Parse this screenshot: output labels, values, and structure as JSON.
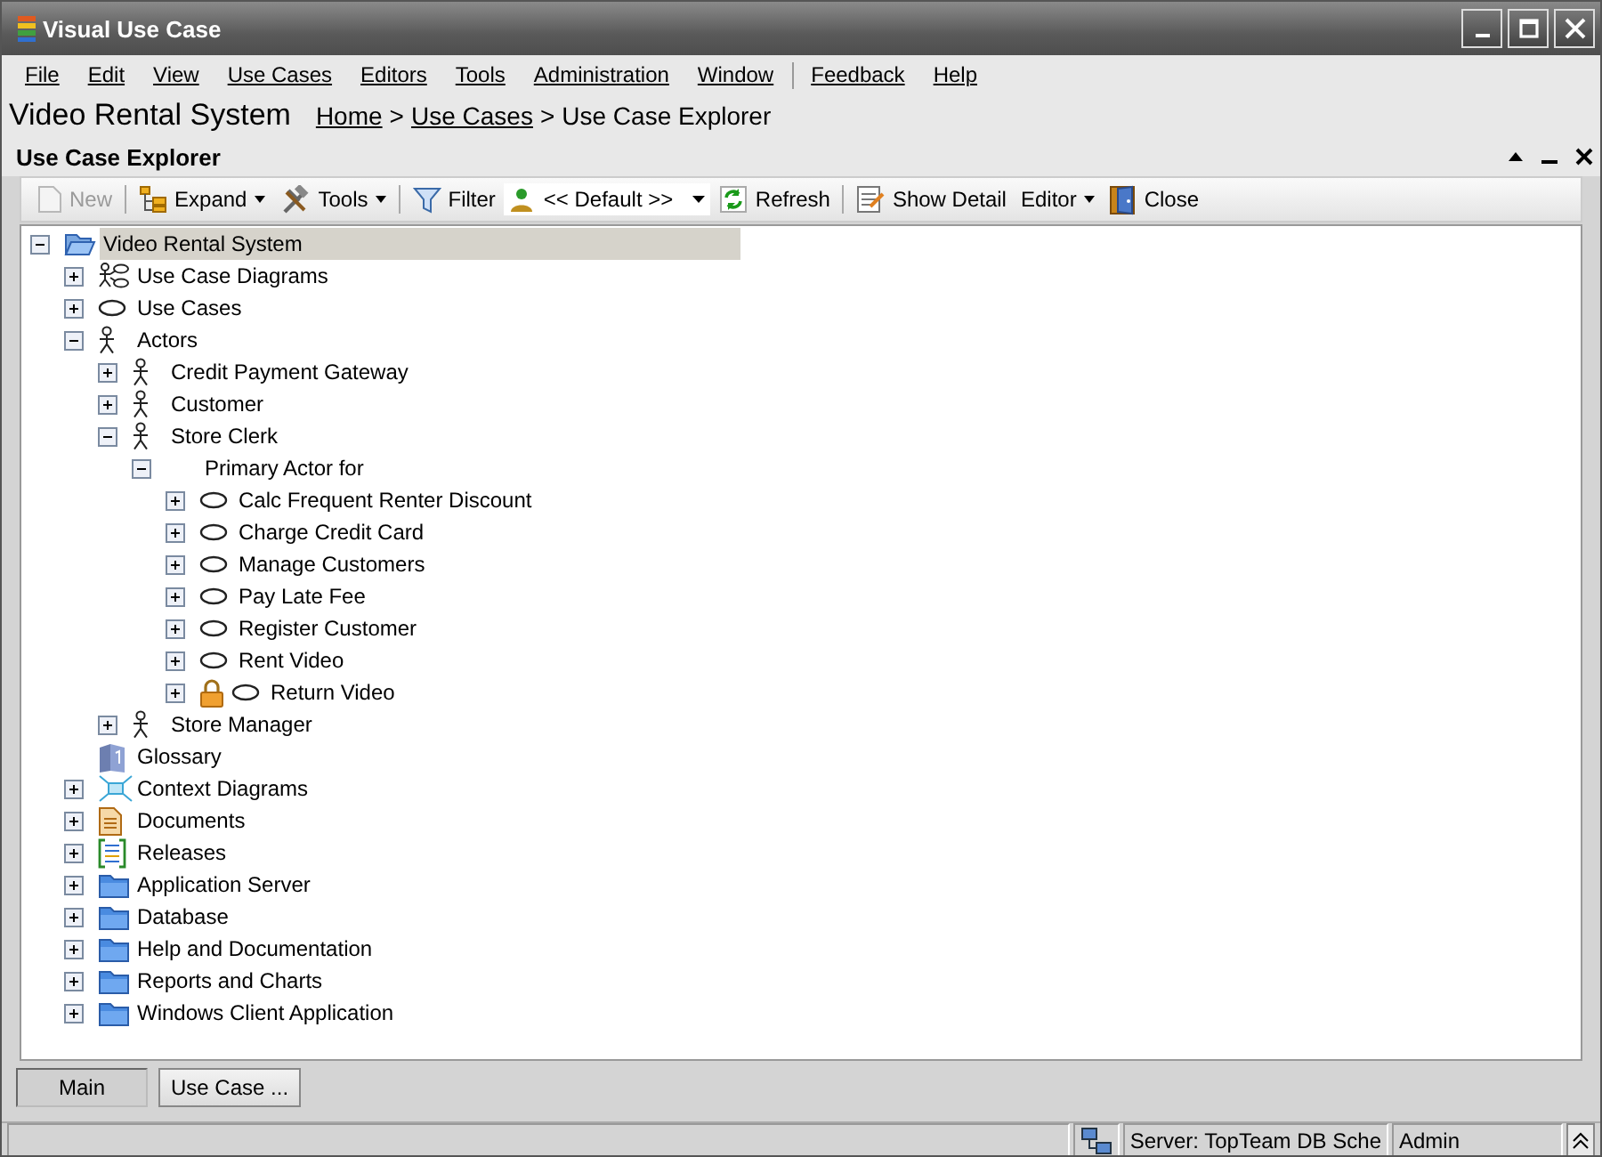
{
  "window": {
    "title": "Visual Use Case"
  },
  "menu": [
    {
      "kind": "item",
      "label": "File"
    },
    {
      "kind": "item",
      "label": "Edit"
    },
    {
      "kind": "item",
      "label": "View"
    },
    {
      "kind": "item",
      "label": "Use Cases"
    },
    {
      "kind": "item",
      "label": "Editors"
    },
    {
      "kind": "item",
      "label": "Tools"
    },
    {
      "kind": "item",
      "label": "Administration"
    },
    {
      "kind": "item",
      "label": "Window"
    },
    {
      "kind": "separator"
    },
    {
      "kind": "item",
      "label": "Feedback"
    },
    {
      "kind": "item",
      "label": "Help"
    }
  ],
  "header": {
    "title": "Video Rental System",
    "breadcrumb": [
      {
        "kind": "link",
        "label": "Home"
      },
      {
        "kind": "sep",
        "label": ">"
      },
      {
        "kind": "link",
        "label": "Use Cases"
      },
      {
        "kind": "sep",
        "label": ">"
      },
      {
        "kind": "text",
        "label": "Use Case Explorer"
      }
    ]
  },
  "panel": {
    "title": "Use Case Explorer"
  },
  "toolbar": [
    {
      "kind": "button",
      "label": "New",
      "disabled": true
    },
    {
      "kind": "separator"
    },
    {
      "kind": "dropdown",
      "label": "Expand",
      "disabled": false
    },
    {
      "kind": "dropdown",
      "label": "Tools",
      "disabled": false
    },
    {
      "kind": "separator"
    },
    {
      "kind": "button",
      "label": "Filter",
      "disabled": false
    },
    {
      "kind": "combo",
      "value": "<< Default >>"
    },
    {
      "kind": "button",
      "label": "Refresh",
      "disabled": false
    },
    {
      "kind": "separator"
    },
    {
      "kind": "button",
      "label": "Show Detail",
      "disabled": false
    },
    {
      "kind": "dropdown",
      "label": "Editor",
      "disabled": false
    },
    {
      "kind": "button",
      "label": "Close",
      "disabled": false
    }
  ],
  "tree": [
    {
      "label": "Video Rental System",
      "kind": "folder-open",
      "expanded": true,
      "selected": true,
      "children": [
        {
          "label": "Use Case Diagrams",
          "kind": "diagram",
          "expanded": false,
          "selected": false
        },
        {
          "label": "Use Cases",
          "kind": "usecase",
          "expanded": false,
          "selected": false
        },
        {
          "label": "Actors",
          "kind": "actor",
          "expanded": true,
          "selected": false,
          "children": [
            {
              "label": "Credit Payment Gateway",
              "kind": "actor",
              "expanded": false,
              "selected": false
            },
            {
              "label": "Customer",
              "kind": "actor",
              "expanded": false,
              "selected": false
            },
            {
              "label": "Store Clerk",
              "kind": "actor",
              "expanded": true,
              "selected": false,
              "children": [
                {
                  "label": "Primary Actor for",
                  "expanded": true,
                  "selected": false,
                  "children": [
                    {
                      "label": "Calc Frequent Renter Discount",
                      "kind": "usecase",
                      "locked": false,
                      "expanded": false,
                      "selected": false
                    },
                    {
                      "label": "Charge Credit Card",
                      "kind": "usecase",
                      "locked": false,
                      "expanded": false,
                      "selected": false
                    },
                    {
                      "label": "Manage Customers",
                      "kind": "usecase",
                      "locked": false,
                      "expanded": false,
                      "selected": false
                    },
                    {
                      "label": "Pay Late Fee",
                      "kind": "usecase",
                      "locked": false,
                      "expanded": false,
                      "selected": false
                    },
                    {
                      "label": "Register Customer",
                      "kind": "usecase",
                      "locked": false,
                      "expanded": false,
                      "selected": false
                    },
                    {
                      "label": "Rent Video",
                      "kind": "usecase",
                      "locked": false,
                      "expanded": false,
                      "selected": false
                    },
                    {
                      "label": "Return Video",
                      "kind": "usecase",
                      "locked": true,
                      "expanded": false,
                      "selected": false
                    }
                  ]
                }
              ]
            },
            {
              "label": "Store Manager",
              "kind": "actor",
              "expanded": false,
              "selected": false
            }
          ]
        },
        {
          "label": "Glossary",
          "kind": "book",
          "selected": false
        },
        {
          "label": "Context Diagrams",
          "kind": "context",
          "expanded": false,
          "selected": false
        },
        {
          "label": "Documents",
          "kind": "document",
          "expanded": false,
          "selected": false
        },
        {
          "label": "Releases",
          "kind": "releases",
          "expanded": false,
          "selected": false
        },
        {
          "label": "Application Server",
          "kind": "folder",
          "expanded": false,
          "selected": false
        },
        {
          "label": "Database",
          "kind": "folder",
          "expanded": false,
          "selected": false
        },
        {
          "label": "Help and Documentation",
          "kind": "folder",
          "expanded": false,
          "selected": false
        },
        {
          "label": "Reports and Charts",
          "kind": "folder",
          "expanded": false,
          "selected": false
        },
        {
          "label": "Windows Client Application",
          "kind": "folder",
          "expanded": false,
          "selected": false
        }
      ]
    }
  ],
  "tabs": [
    {
      "label": "Main",
      "selected": true
    },
    {
      "label": "Use Case ...",
      "selected": false
    }
  ],
  "status_bar": {
    "server": "Server: TopTeam DB Sche",
    "user": "Admin"
  }
}
